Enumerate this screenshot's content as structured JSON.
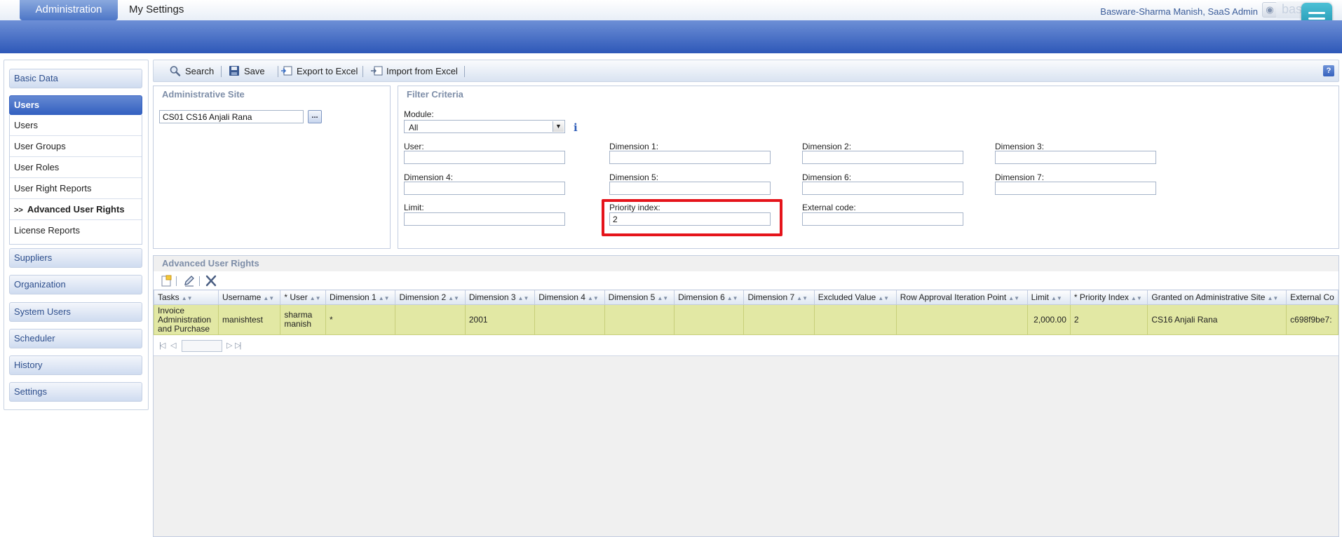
{
  "top": {
    "tabs": [
      "Administration",
      "My Settings"
    ],
    "user": "Basware-Sharma Manish, SaaS Admin",
    "logo_text": "bas"
  },
  "sidebar": {
    "groups": [
      "Basic Data",
      "Users",
      "Suppliers",
      "Organization",
      "System Users",
      "Scheduler",
      "History",
      "Settings"
    ],
    "users_sub": [
      "Users",
      "User Groups",
      "User Roles",
      "User Right Reports",
      "Advanced User Rights",
      "License Reports"
    ],
    "selected_marker": ">>"
  },
  "toolbar": {
    "search": "Search",
    "save": "Save",
    "export": "Export to Excel",
    "import": "Import from Excel",
    "help": "?"
  },
  "admin_site": {
    "title": "Administrative Site",
    "value": "CS01 CS16 Anjali Rana",
    "browse": "..."
  },
  "filter": {
    "title": "Filter Criteria",
    "module_label": "Module:",
    "module_value": "All",
    "fields": {
      "user": {
        "label": "User:",
        "value": ""
      },
      "dim1": {
        "label": "Dimension 1:",
        "value": ""
      },
      "dim2": {
        "label": "Dimension 2:",
        "value": ""
      },
      "dim3": {
        "label": "Dimension 3:",
        "value": ""
      },
      "dim4": {
        "label": "Dimension 4:",
        "value": ""
      },
      "dim5": {
        "label": "Dimension 5:",
        "value": ""
      },
      "dim6": {
        "label": "Dimension 6:",
        "value": ""
      },
      "dim7": {
        "label": "Dimension 7:",
        "value": ""
      },
      "limit": {
        "label": "Limit:",
        "value": ""
      },
      "priority": {
        "label": "Priority index:",
        "value": "2"
      },
      "external": {
        "label": "External code:",
        "value": ""
      }
    }
  },
  "grid": {
    "title": "Advanced User Rights",
    "columns": [
      "Tasks",
      "Username",
      "* User",
      "Dimension 1",
      "Dimension 2",
      "Dimension 3",
      "Dimension 4",
      "Dimension 5",
      "Dimension 6",
      "Dimension 7",
      "Excluded Value",
      "Row Approval Iteration Point",
      "Limit",
      "* Priority Index",
      "Granted on Administrative Site",
      "External Co"
    ],
    "rows": [
      [
        "Invoice Administration and Purchase",
        "manishtest",
        "sharma manish",
        "*",
        "",
        "2001",
        "",
        "",
        "",
        "",
        "",
        "",
        "2,000.00",
        "2",
        "CS16 Anjali Rana",
        "c698f9be7:"
      ]
    ]
  },
  "colors": {
    "banner": "#3e67c2",
    "row_highlight": "#e2e8a4",
    "highlight_border": "#e5141b",
    "menu_button": "#1f9ab8"
  }
}
